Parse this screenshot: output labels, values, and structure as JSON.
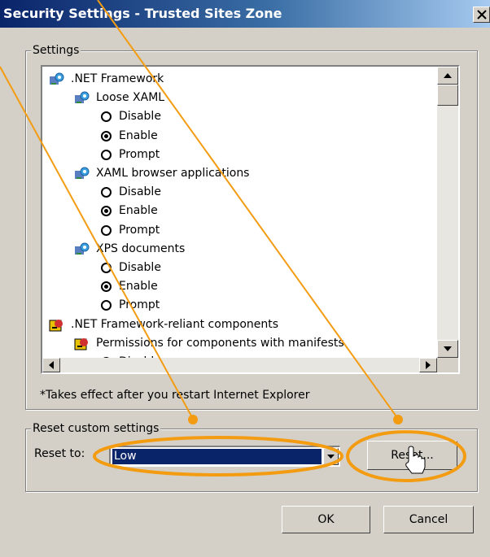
{
  "window": {
    "title": "Security Settings - Trusted Sites Zone",
    "close_label": "X"
  },
  "settings_group": {
    "label": "Settings"
  },
  "tree": [
    {
      "label": ".NET Framework",
      "kind": "category",
      "icon": "gear-net-icon"
    },
    {
      "label": "Loose XAML",
      "kind": "category",
      "icon": "gear-net-icon"
    },
    {
      "label": "Disable",
      "kind": "radio",
      "checked": false
    },
    {
      "label": "Enable",
      "kind": "radio",
      "checked": true
    },
    {
      "label": "Prompt",
      "kind": "radio",
      "checked": false
    },
    {
      "label": "XAML browser applications",
      "kind": "category",
      "icon": "gear-net-icon"
    },
    {
      "label": "Disable",
      "kind": "radio",
      "checked": false
    },
    {
      "label": "Enable",
      "kind": "radio",
      "checked": true
    },
    {
      "label": "Prompt",
      "kind": "radio",
      "checked": false
    },
    {
      "label": "XPS documents",
      "kind": "category",
      "icon": "gear-net-icon"
    },
    {
      "label": "Disable",
      "kind": "radio",
      "checked": false
    },
    {
      "label": "Enable",
      "kind": "radio",
      "checked": true
    },
    {
      "label": "Prompt",
      "kind": "radio",
      "checked": false
    },
    {
      "label": ".NET Framework-reliant components",
      "kind": "category",
      "icon": "components-icon"
    },
    {
      "label": "Permissions for components with manifests",
      "kind": "category",
      "icon": "components-icon"
    },
    {
      "label": "Disable",
      "kind": "radio",
      "checked": false
    }
  ],
  "note": "*Takes effect after you restart Internet Explorer",
  "reset_group": {
    "label": "Reset custom settings",
    "reset_to_label": "Reset to:",
    "selected_level": "Low",
    "reset_button": "Reset..."
  },
  "buttons": {
    "ok": "OK",
    "cancel": "Cancel"
  },
  "colors": {
    "annotation": "#f39c12",
    "title_bar": "#0a246a",
    "selection": "#0a246a"
  }
}
